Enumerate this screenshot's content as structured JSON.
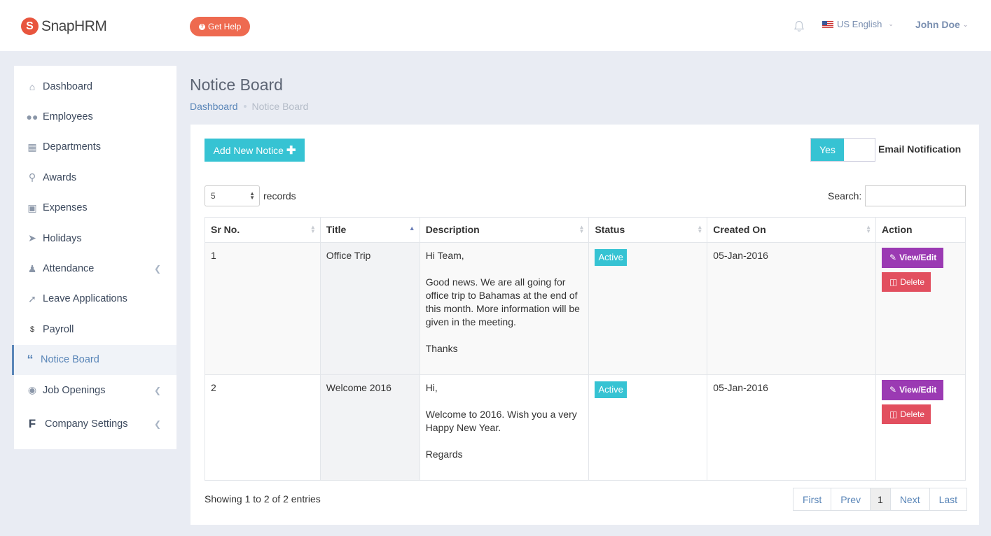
{
  "header": {
    "logo_text": "SnapHRM",
    "help_label": "Get Help",
    "language": "US English",
    "user_name": "John Doe"
  },
  "sidebar": {
    "items": [
      {
        "label": "Dashboard",
        "icon": "home-icon"
      },
      {
        "label": "Employees",
        "icon": "users-icon"
      },
      {
        "label": "Departments",
        "icon": "briefcase-icon"
      },
      {
        "label": "Awards",
        "icon": "trophy-icon"
      },
      {
        "label": "Expenses",
        "icon": "money-icon"
      },
      {
        "label": "Holidays",
        "icon": "paper-plane-icon"
      },
      {
        "label": "Attendance",
        "icon": "user-icon"
      },
      {
        "label": "Leave Applications",
        "icon": "rocket-icon"
      },
      {
        "label": "Payroll",
        "icon": "dollar-icon"
      },
      {
        "label": "Notice Board",
        "icon": "quote-icon"
      },
      {
        "label": "Job Openings",
        "icon": "globe-icon"
      },
      {
        "label": "Company Settings",
        "icon": "f-icon"
      }
    ]
  },
  "page": {
    "title": "Notice Board",
    "breadcrumb_home": "Dashboard",
    "breadcrumb_current": "Notice Board"
  },
  "toolbar": {
    "add_label": "Add New Notice",
    "toggle_label": "Yes",
    "email_label": "Email Notification",
    "records_value": "5",
    "records_label": "records",
    "search_label": "Search:"
  },
  "table": {
    "headers": [
      "Sr No.",
      "Title",
      "Description",
      "Status",
      "Created On",
      "Action"
    ],
    "rows": [
      {
        "sr": "1",
        "title": "Office Trip",
        "desc": [
          "Hi Team,",
          "Good news. We are all going for office trip to Bahamas at the end of this month. More information will be given in the meeting.",
          "Thanks"
        ],
        "status": "Active",
        "created": "05-Jan-2016",
        "view_label": "View/Edit",
        "delete_label": "Delete"
      },
      {
        "sr": "2",
        "title": "Welcome 2016",
        "desc": [
          "Hi,",
          "Welcome to 2016. Wish you a very Happy New Year.",
          "Regards"
        ],
        "status": "Active",
        "created": "05-Jan-2016",
        "view_label": "View/Edit",
        "delete_label": "Delete"
      }
    ]
  },
  "footer": {
    "showing": "Showing 1 to 2 of 2 entries",
    "pager": [
      "First",
      "Prev",
      "1",
      "Next",
      "Last"
    ]
  },
  "colors": {
    "accent": "#36c3d3",
    "view_button": "#9b3ab3",
    "delete_button": "#e24f5f",
    "help_button": "#ee6a50",
    "link": "#5a86b8"
  }
}
